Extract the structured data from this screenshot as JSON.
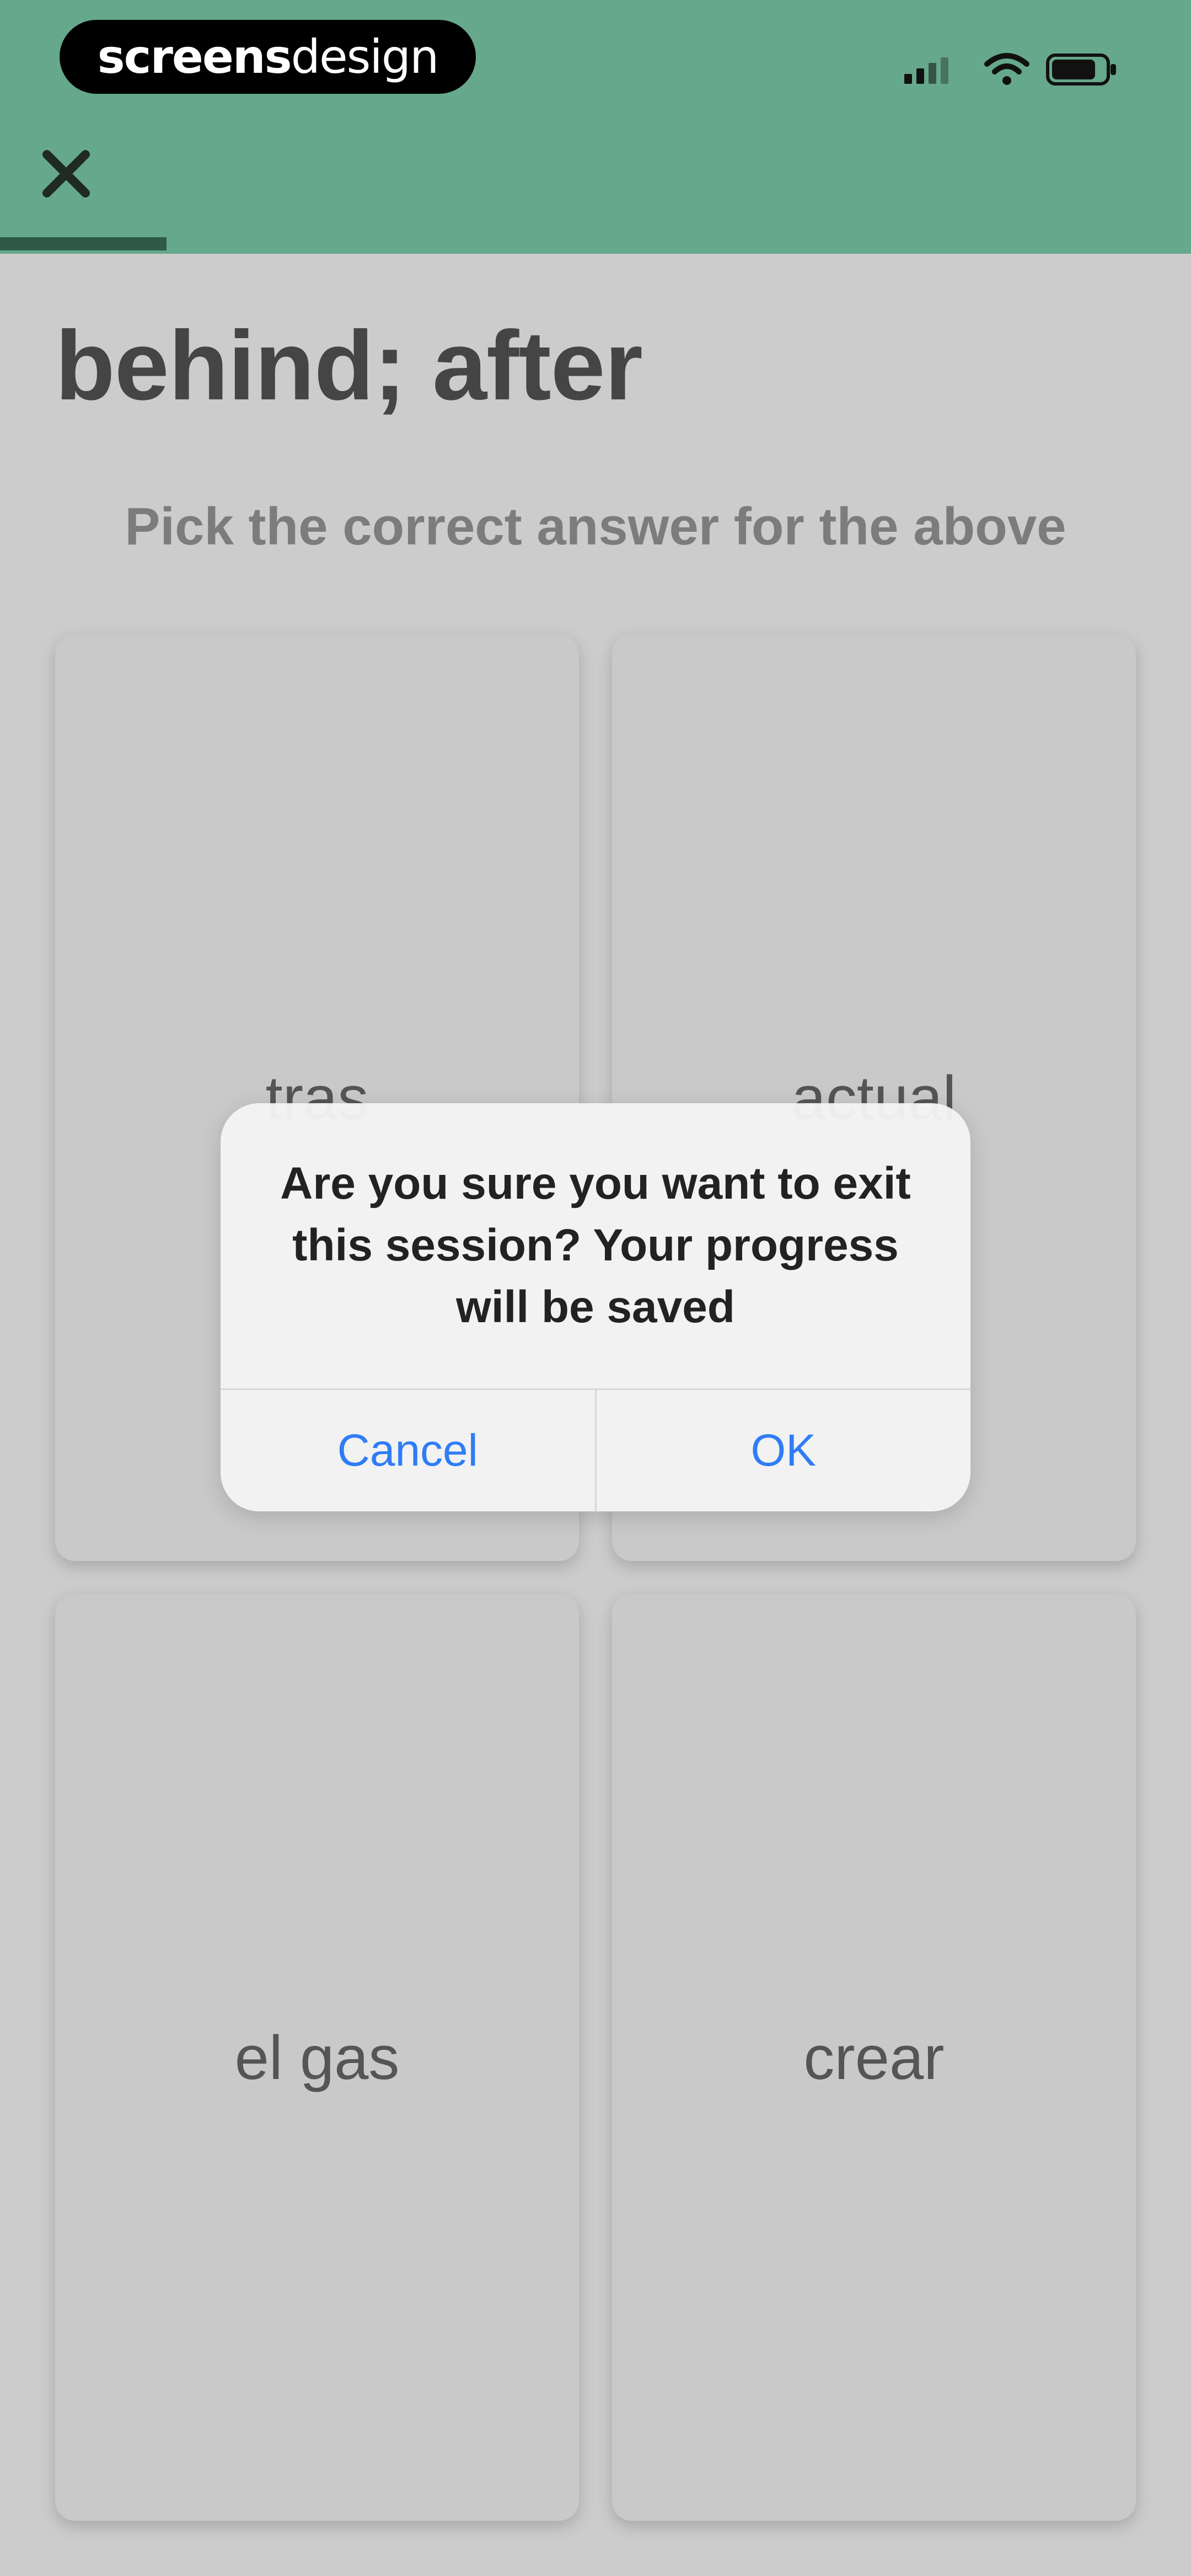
{
  "brand": {
    "part1": "screens",
    "part2": "design"
  },
  "session": {
    "progress": 0.14
  },
  "question": {
    "prompt": "behind; after",
    "instruction": "Pick the correct answer for the above"
  },
  "answers": [
    {
      "label": "tras"
    },
    {
      "label": "actual"
    },
    {
      "label": "el gas"
    },
    {
      "label": "crear"
    }
  ],
  "dialog": {
    "message": "Are you sure you want to exit this session? Your progress will be saved",
    "cancel_label": "Cancel",
    "ok_label": "OK"
  },
  "colors": {
    "header": "#66a88b",
    "progress_fill": "#2f5a47",
    "accent": "#2f7cf6"
  },
  "icons": {
    "close": "close-icon",
    "signal": "signal-icon",
    "wifi": "wifi-icon",
    "battery": "battery-icon"
  }
}
